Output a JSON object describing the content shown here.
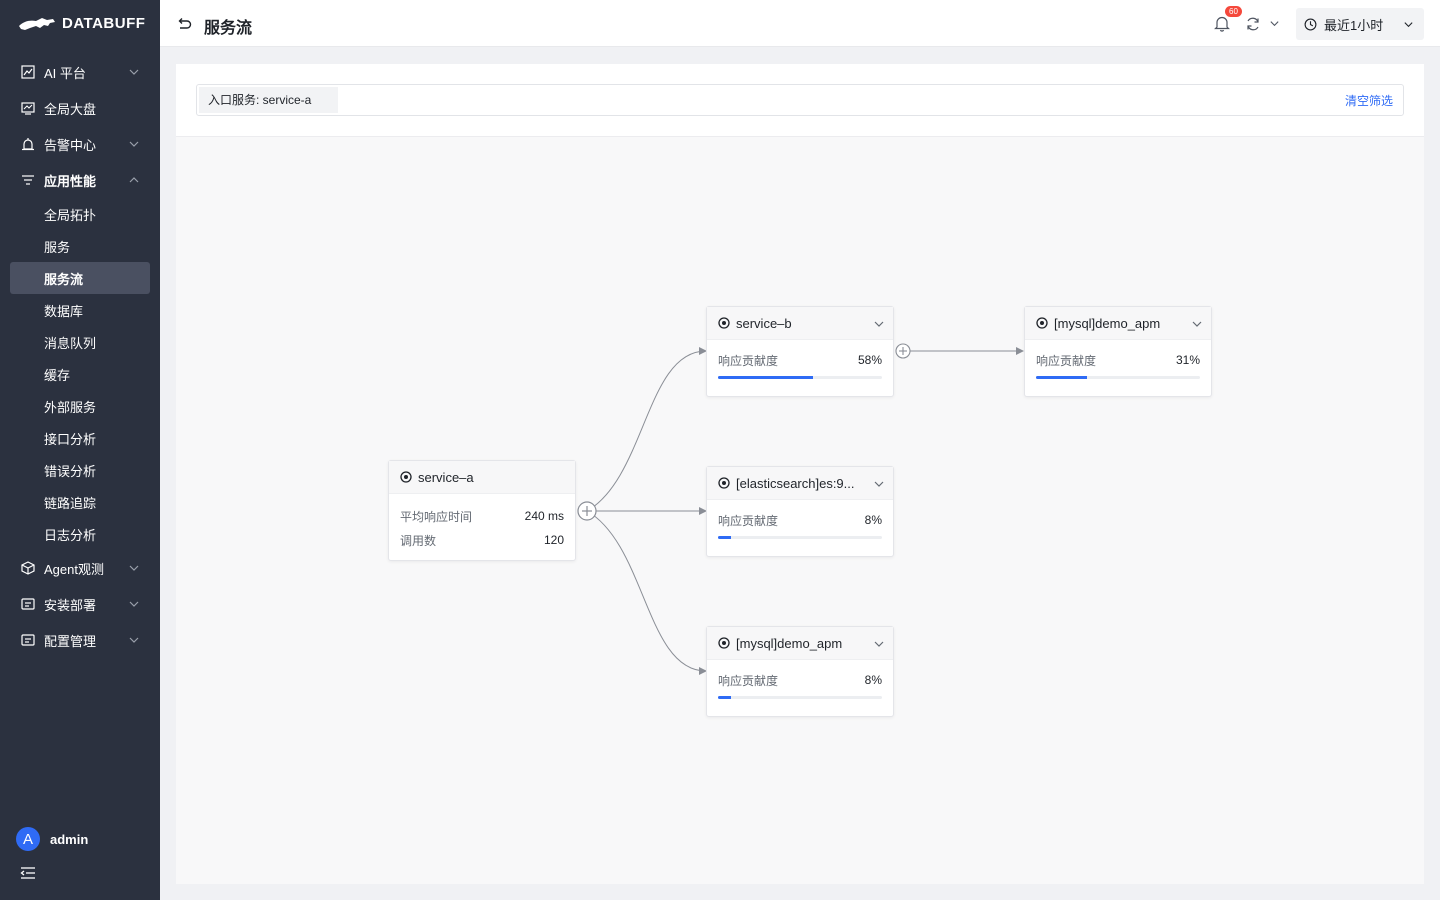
{
  "app": {
    "brand": "DATABUFF"
  },
  "sidebar": {
    "items": [
      {
        "label": "AI 平台",
        "icon": "ai-chart-icon",
        "expandable": true
      },
      {
        "label": "全局大盘",
        "icon": "dashboard-icon",
        "expandable": false
      },
      {
        "label": "告警中心",
        "icon": "alarm-icon",
        "expandable": true
      },
      {
        "label": "应用性能",
        "icon": "filter-icon",
        "expandable": true,
        "expanded": true
      }
    ],
    "subitems": [
      "全局拓扑",
      "服务",
      "服务流",
      "数据库",
      "消息队列",
      "缓存",
      "外部服务",
      "接口分析",
      "错误分析",
      "链路追踪",
      "日志分析"
    ],
    "active_subitem": "服务流",
    "bottom_items": [
      {
        "label": "Agent观测",
        "icon": "cube-icon"
      },
      {
        "label": "安装部署",
        "icon": "install-icon"
      },
      {
        "label": "配置管理",
        "icon": "config-icon"
      }
    ],
    "user": {
      "initial": "A",
      "name": "admin"
    }
  },
  "header": {
    "title": "服务流",
    "notification_count": "60",
    "time_range": "最近1小时"
  },
  "filter": {
    "tag": "入口服务: service-a",
    "clear_label": "清空筛选"
  },
  "graph": {
    "root": {
      "name": "service–a",
      "metrics": [
        {
          "label": "平均响应时间",
          "value": "240 ms"
        },
        {
          "label": "调用数",
          "value": "120"
        }
      ]
    },
    "nodes": [
      {
        "id": "service-b",
        "name": "service–b",
        "metric_label": "响应贡献度",
        "percent": 58
      },
      {
        "id": "elasticsearch",
        "name": "[elasticsearch]es:9...",
        "metric_label": "响应贡献度",
        "percent": 8
      },
      {
        "id": "mysql-1",
        "name": "[mysql]demo_apm",
        "metric_label": "响应贡献度",
        "percent": 8
      },
      {
        "id": "mysql-2",
        "name": "[mysql]demo_apm",
        "metric_label": "响应贡献度",
        "percent": 31
      }
    ],
    "colors": {
      "bar": "#2f6bf5",
      "track": "#eceef1",
      "edge": "#8a8e96"
    }
  }
}
